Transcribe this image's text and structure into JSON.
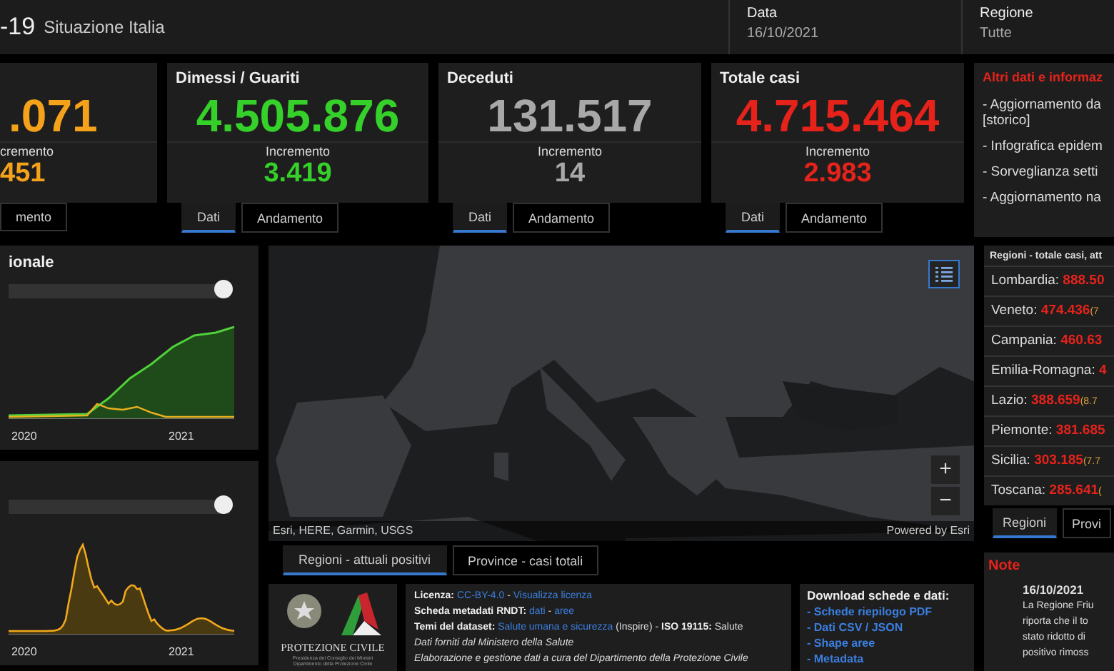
{
  "header": {
    "title": "-19",
    "subtitle": "Situazione Italia",
    "filters": [
      {
        "label": "Data",
        "value": "16/10/2021"
      },
      {
        "label": "Regione",
        "value": "Tutte"
      }
    ]
  },
  "cards": [
    {
      "value": ".071",
      "increment_label": "cremento",
      "increment": "451",
      "color": "#f5a21b",
      "tabs": [
        {
          "label": "mento",
          "selected": false
        }
      ]
    },
    {
      "title": "Dimessi / Guariti",
      "value": "4.505.876",
      "increment_label": "Incremento",
      "increment": "3.419",
      "color": "#35d12a",
      "tabs": [
        {
          "label": "Dati",
          "selected": true
        },
        {
          "label": "Andamento",
          "selected": false
        }
      ]
    },
    {
      "title": "Deceduti",
      "value": "131.517",
      "increment_label": "Incremento",
      "increment": "14",
      "color": "#a8a8a8",
      "tabs": [
        {
          "label": "Dati",
          "selected": true
        },
        {
          "label": "Andamento",
          "selected": false
        }
      ]
    },
    {
      "title": "Totale casi",
      "value": "4.715.464",
      "increment_label": "Incremento",
      "increment": "2.983",
      "color": "#e5231b",
      "tabs": [
        {
          "label": "Dati",
          "selected": true
        },
        {
          "label": "Andamento",
          "selected": false
        }
      ]
    }
  ],
  "info_panel": {
    "title": "Altri dati e informaz",
    "items": [
      "- Aggiornamento da\n[storico]",
      "- Infografica epidem",
      "- Sorveglianza setti",
      "- Aggiornamento na"
    ]
  },
  "charts": [
    {
      "title": "ionale",
      "kind": "cumulative",
      "slider": {
        "level": 0.97
      },
      "x_labels": [
        "2020",
        "2021"
      ]
    },
    {
      "kind": "daily",
      "slider": {
        "level": 0.97
      },
      "x_labels": [
        "2020",
        "2021"
      ]
    }
  ],
  "map": {
    "kind": "picture",
    "attribution": "Esri, HERE, Garmin, USGS",
    "powered_by": "Powered by Esri",
    "zoom_in": "+",
    "zoom_out": "−",
    "tabs": [
      {
        "label": "Regioni - attuali positivi",
        "selected": true
      },
      {
        "label": "Province - casi totali",
        "selected": false
      }
    ]
  },
  "logo": {
    "name": "PROTEZIONE CIVILE",
    "caption": "Presidenza del Consiglio dei Ministri\nDipartimento della Protezione Civile"
  },
  "license": [
    [
      {
        "kind": "bold",
        "text": "Licenza: "
      },
      {
        "kind": "link",
        "text": "CC-BY-4.0"
      },
      {
        "kind": "plain",
        "text": " - "
      },
      {
        "kind": "link",
        "text": "Visualizza licenza"
      }
    ],
    [
      {
        "kind": "bold",
        "text": "Scheda metadati RNDT: "
      },
      {
        "kind": "link",
        "text": "dati"
      },
      {
        "kind": "plain",
        "text": " - "
      },
      {
        "kind": "link",
        "text": "aree"
      }
    ],
    [
      {
        "kind": "bold",
        "text": "Temi del dataset: "
      },
      {
        "kind": "link",
        "text": "Salute umana e sicurezza"
      },
      {
        "kind": "plain",
        "text": " (Inspire) - "
      },
      {
        "kind": "bold",
        "text": "ISO 19115: "
      },
      {
        "kind": "plain",
        "text": "Salute"
      }
    ],
    [
      {
        "kind": "italic",
        "text": "Dati forniti dal Ministero della Salute"
      }
    ],
    [
      {
        "kind": "italic",
        "text": "Elaborazione e gestione dati a cura del Dipartimento della Protezione Civile"
      }
    ]
  ],
  "downloads": {
    "title": "Download schede e dati:",
    "links": [
      "- Schede riepilogo PDF",
      "- Dati CSV / JSON",
      "- Shape aree",
      "- Metadata"
    ]
  },
  "regions": {
    "title": "Regioni - totale casi, att",
    "rows": [
      {
        "name": "Lombardia: ",
        "value": "888.50"
      },
      {
        "name": "Veneto: ",
        "value": "474.436",
        "extra": "(7"
      },
      {
        "name": "Campania: ",
        "value": "460.63"
      },
      {
        "name": "Emilia-Romagna: ",
        "value": "4"
      },
      {
        "name": "Lazio: ",
        "value": "388.659",
        "extra": "(8.7"
      },
      {
        "name": "Piemonte: ",
        "value": "381.685"
      },
      {
        "name": "Sicilia: ",
        "value": "303.185",
        "extra": "(7.7"
      },
      {
        "name": "Toscana: ",
        "value": "285.641",
        "extra": "("
      }
    ],
    "tabs": [
      {
        "label": "Regioni",
        "selected": true
      },
      {
        "label": "Provi",
        "selected": false
      }
    ]
  },
  "note": {
    "title": "Note",
    "date": "16/10/2021",
    "lines": [
      "La Regione Friu",
      "riporta che il to",
      "stato ridotto di",
      "positivo rimoss"
    ]
  }
}
